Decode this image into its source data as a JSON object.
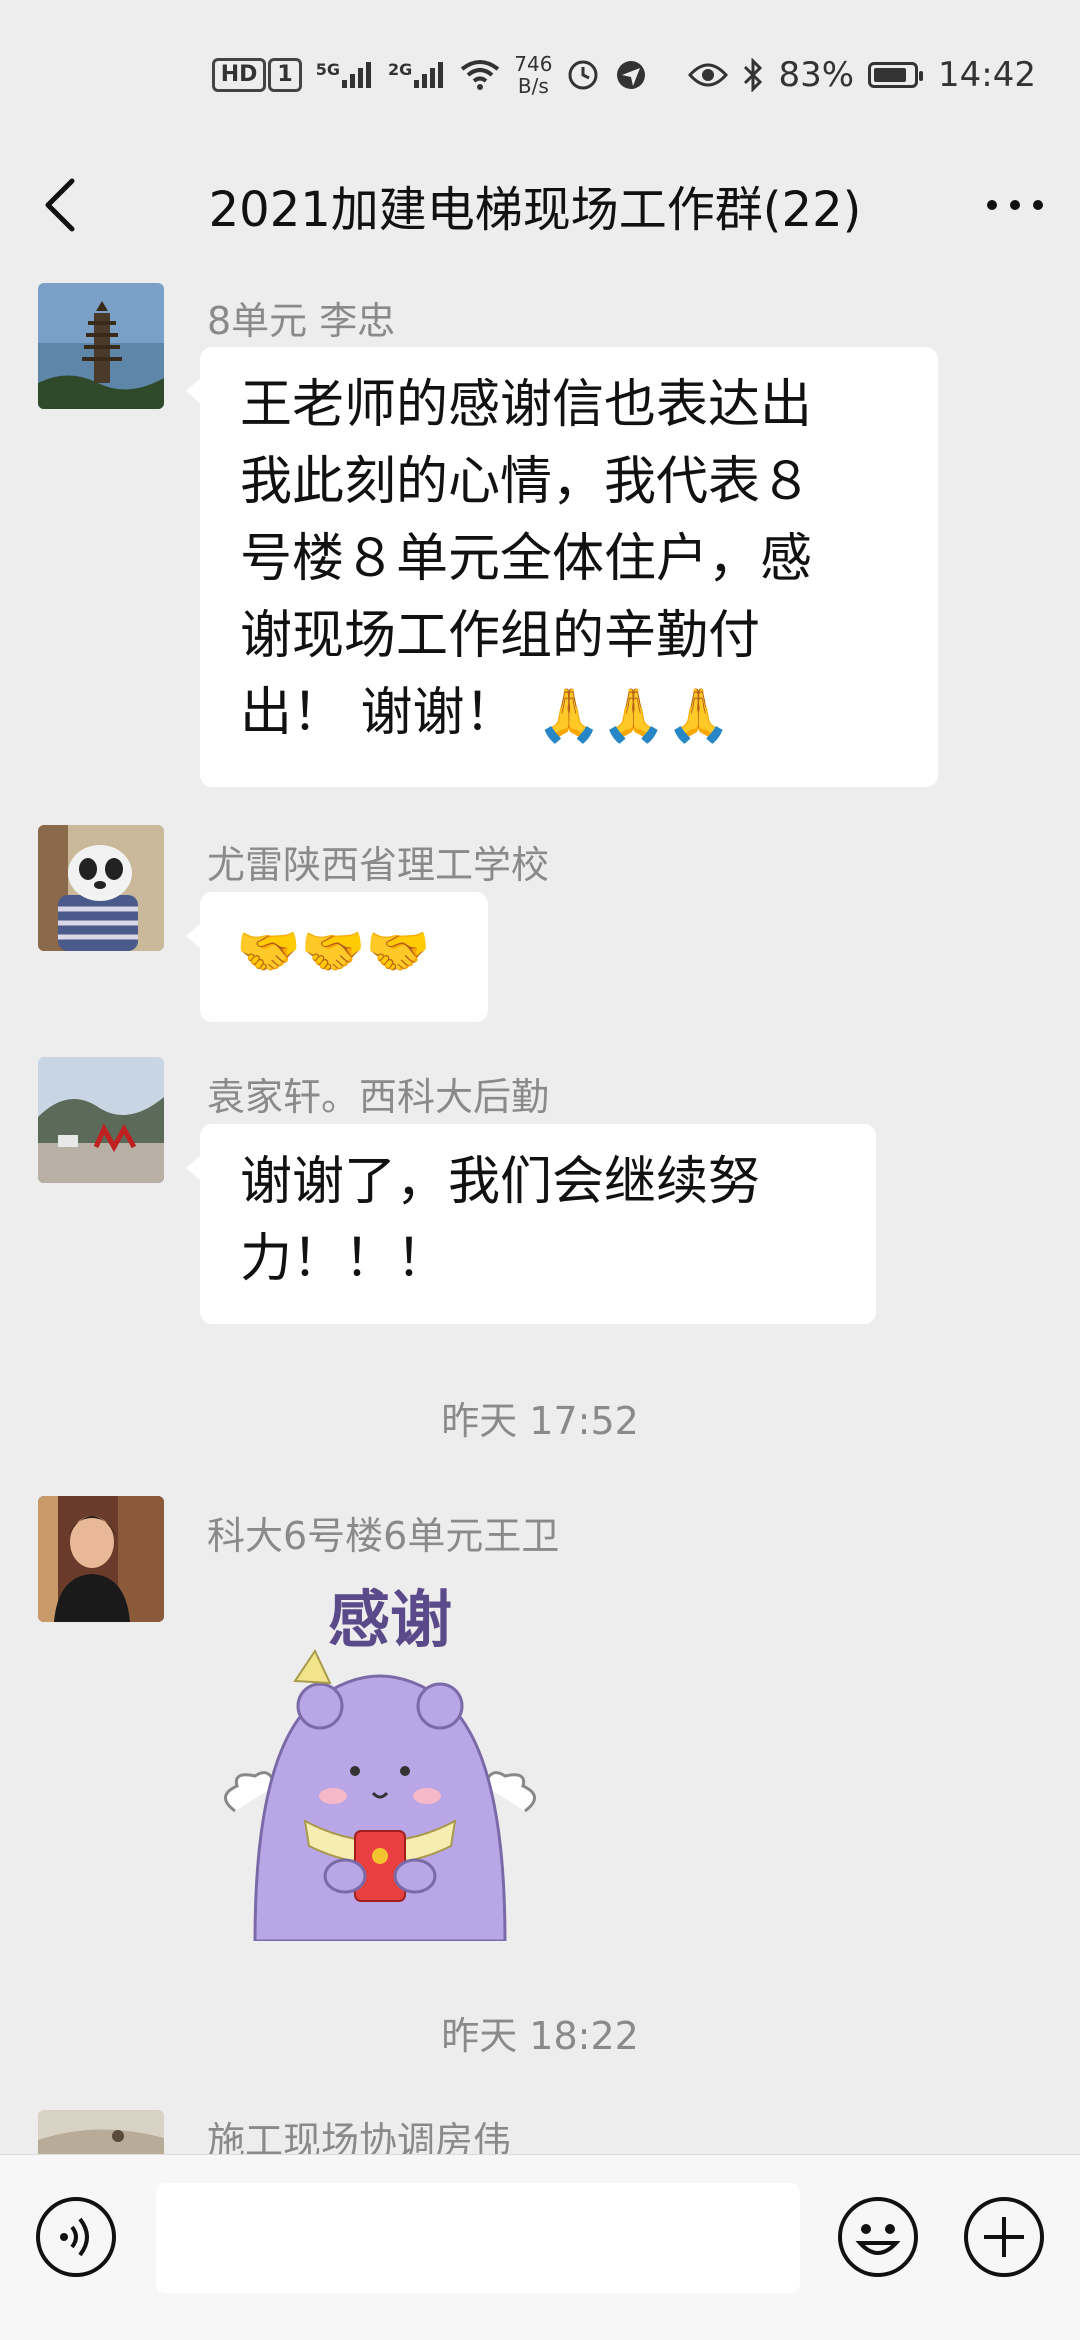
{
  "status_bar": {
    "hd_label": "HD",
    "sim_label": "1",
    "signal1_label": "5G",
    "signal2_label": "2G",
    "net_speed_value": "746",
    "net_speed_unit": "B/s",
    "battery_percent": "83%",
    "battery_level": 0.83,
    "time": "14:42",
    "icons": [
      "hd-icon",
      "signal-icon",
      "signal-icon",
      "wifi-icon",
      "alarm-icon",
      "location-icon",
      "eye-icon",
      "bluetooth-icon",
      "battery-icon"
    ]
  },
  "header": {
    "title": "2021加建电梯现场工作群(22)",
    "back_icon": "chevron-left-icon",
    "more_icon": "more-horizontal-icon"
  },
  "messages": [
    {
      "sender": "8单元 李忠",
      "lines": [
        "王老师的感谢信也表达出",
        "我此刻的心情，我代表８",
        "号楼８单元全体住户，感",
        "谢现场工作组的辛勤付"
      ],
      "last_line": "出！ 谢谢！",
      "emoji": "🙏🙏🙏"
    },
    {
      "sender": "尤雷陕西省理工学校",
      "emoji": "🤝🤝🤝"
    },
    {
      "sender": "袁家轩。西科大后勤",
      "lines": [
        "谢谢了，我们会继续努",
        "力！！！"
      ]
    },
    {
      "sender": "科大6号楼6单元王卫",
      "sticker_text": "感谢"
    },
    {
      "sender": "施工现场协调房伟"
    }
  ],
  "timestamps": [
    "昨天 17:52",
    "昨天 18:22"
  ],
  "input_bar": {
    "voice_icon": "voice-icon",
    "emoji_icon": "smiley-icon",
    "plus_icon": "plus-circle-icon",
    "input_value": ""
  },
  "colors": {
    "background": "#ededed",
    "bubble": "#ffffff",
    "sender_text": "#8a8a8a",
    "sticker_body": "#b9a6e6"
  }
}
